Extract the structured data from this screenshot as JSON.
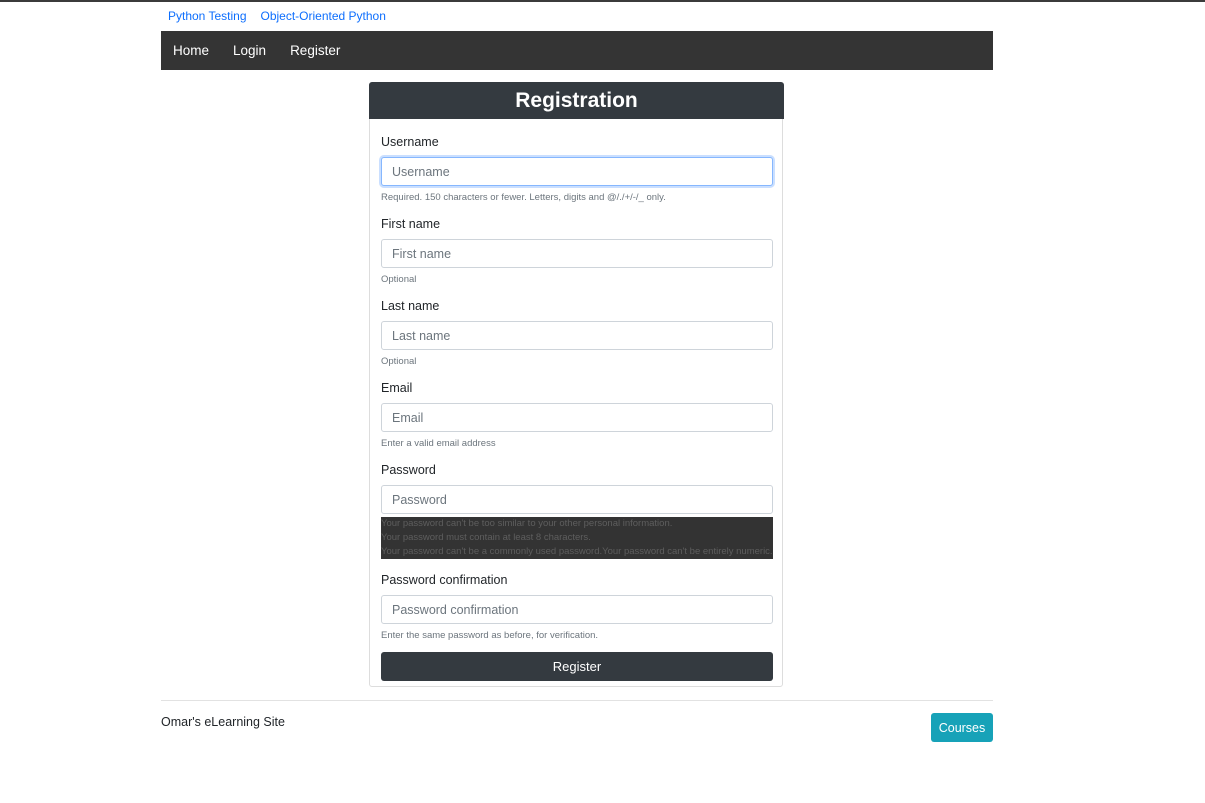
{
  "top_links": [
    "Python Testing",
    "Object-Oriented Python"
  ],
  "navbar": {
    "items": [
      "Home",
      "Login",
      "Register"
    ]
  },
  "form": {
    "title": "Registration",
    "fields": {
      "username": {
        "label": "Username",
        "placeholder": "Username",
        "help": "Required. 150 characters or fewer. Letters, digits and @/./+/-/_ only."
      },
      "first_name": {
        "label": "First name",
        "placeholder": "First name",
        "help": "Optional"
      },
      "last_name": {
        "label": "Last name",
        "placeholder": "Last name",
        "help": "Optional"
      },
      "email": {
        "label": "Email",
        "placeholder": "Email",
        "help": "Enter a valid email address"
      },
      "password": {
        "label": "Password",
        "placeholder": "Password",
        "help_lines": [
          "Your password can't be too similar to your other personal information.",
          "Your password must contain at least 8 characters.",
          "Your password can't be a commonly used password.Your password can't be entirely numeric."
        ]
      },
      "password_confirmation": {
        "label": "Password confirmation",
        "placeholder": "Password confirmation",
        "help": "Enter the same password as before, for verification."
      }
    },
    "submit_label": "Register"
  },
  "footer": {
    "site_name": "Omar's eLearning Site",
    "courses_label": "Courses"
  },
  "colors": {
    "navbar_bg": "#343434",
    "card_header_bg": "#343a40",
    "link": "#0d6efd",
    "courses_button": "#17a2b8"
  }
}
